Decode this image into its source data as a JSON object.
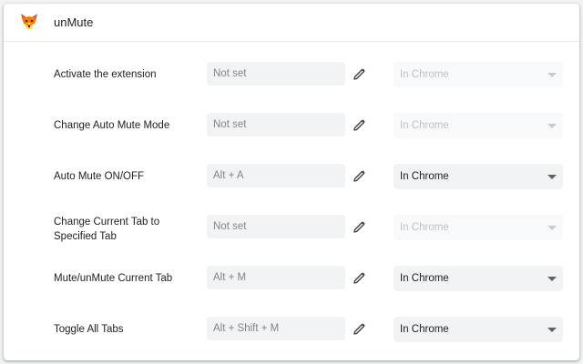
{
  "extension": {
    "name": "unMute",
    "icon": "fox-icon"
  },
  "commands": [
    {
      "label": "Activate the extension",
      "shortcut": "Not set",
      "scope": "In Chrome",
      "scope_enabled": false
    },
    {
      "label": "Change Auto Mute Mode",
      "shortcut": "Not set",
      "scope": "In Chrome",
      "scope_enabled": false
    },
    {
      "label": "Auto Mute ON/OFF",
      "shortcut": "Alt + A",
      "scope": "In Chrome",
      "scope_enabled": true
    },
    {
      "label": "Change Current Tab to Specified Tab",
      "shortcut": "Not set",
      "scope": "In Chrome",
      "scope_enabled": false
    },
    {
      "label": "Mute/unMute Current Tab",
      "shortcut": "Alt + M",
      "scope": "In Chrome",
      "scope_enabled": true
    },
    {
      "label": "Toggle All Tabs",
      "shortcut": "Alt + Shift + M",
      "scope": "In Chrome",
      "scope_enabled": true
    }
  ],
  "colors": {
    "accent_orange": "#f57c00",
    "text_primary": "#202124",
    "text_secondary": "#80868b",
    "field_background": "#f1f3f4"
  }
}
